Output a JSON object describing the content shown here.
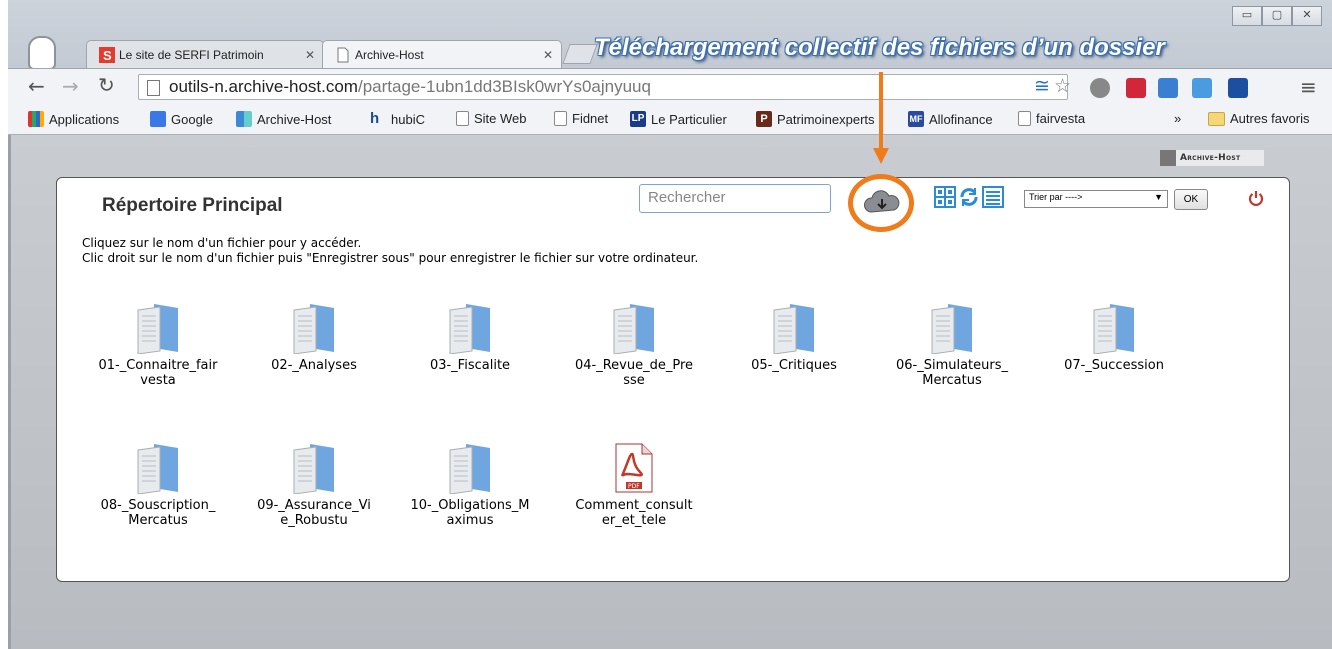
{
  "tabs": [
    {
      "title": "Le site de SERFI Patrimoin",
      "active": false
    },
    {
      "title": "Archive-Host",
      "active": true
    }
  ],
  "annotation": "Téléchargement collectif des fichiers d’un dossier",
  "address": {
    "host": "outils-n.archive-host.com",
    "path": "/partage-1ubn1dd3BIsk0wrYs0ajnyuuq"
  },
  "bookmarks": [
    {
      "label": "Applications",
      "icon": "apps-grid-icon"
    },
    {
      "label": "Google",
      "icon": "google-icon"
    },
    {
      "label": "Archive-Host",
      "icon": "archive-host-icon"
    },
    {
      "label": "hubiC",
      "icon": "hubic-icon"
    },
    {
      "label": "Site Web",
      "icon": "page-icon"
    },
    {
      "label": "Fidnet",
      "icon": "page-icon"
    },
    {
      "label": "Le Particulier",
      "icon": "lp-icon"
    },
    {
      "label": "Patrimoinexperts",
      "icon": "p-icon"
    },
    {
      "label": "Allofinance",
      "icon": "mf-icon"
    },
    {
      "label": "fairvesta",
      "icon": "page-icon"
    },
    {
      "label": "»",
      "icon": ""
    },
    {
      "label": "Autres favoris",
      "icon": "folder-icon"
    }
  ],
  "brand": "Archive-Host",
  "panel": {
    "title": "Répertoire Principal",
    "instructions": [
      "Cliquez sur le nom d'un fichier pour y accéder.",
      "Clic droit sur le nom d'un fichier puis \"Enregistrer sous\" pour enregistrer le fichier sur votre ordinateur."
    ],
    "search_placeholder": "Rechercher",
    "sort_label": "Trier par ---->",
    "ok_label": "OK"
  },
  "items": [
    {
      "label": "01-_Connaitre_fairvesta",
      "type": "folder"
    },
    {
      "label": "02-_Analyses",
      "type": "folder"
    },
    {
      "label": "03-_Fiscalite",
      "type": "folder"
    },
    {
      "label": "04-_Revue_de_Presse",
      "type": "folder"
    },
    {
      "label": "05-_Critiques",
      "type": "folder"
    },
    {
      "label": "06-_Simulateurs_Mercatus",
      "type": "folder"
    },
    {
      "label": "07-_Succession",
      "type": "folder"
    },
    {
      "label": "08-_Souscription_Mercatus",
      "type": "folder"
    },
    {
      "label": "09-_Assurance_Vie_Robustu",
      "type": "folder"
    },
    {
      "label": "10-_Obligations_Maximus",
      "type": "folder"
    },
    {
      "label": "Comment_consulter_et_tele",
      "type": "pdf"
    }
  ],
  "colors": {
    "accent_orange": "#f07b1b",
    "annotation_blue": "#3a6fb0",
    "power_red": "#c0392b"
  }
}
